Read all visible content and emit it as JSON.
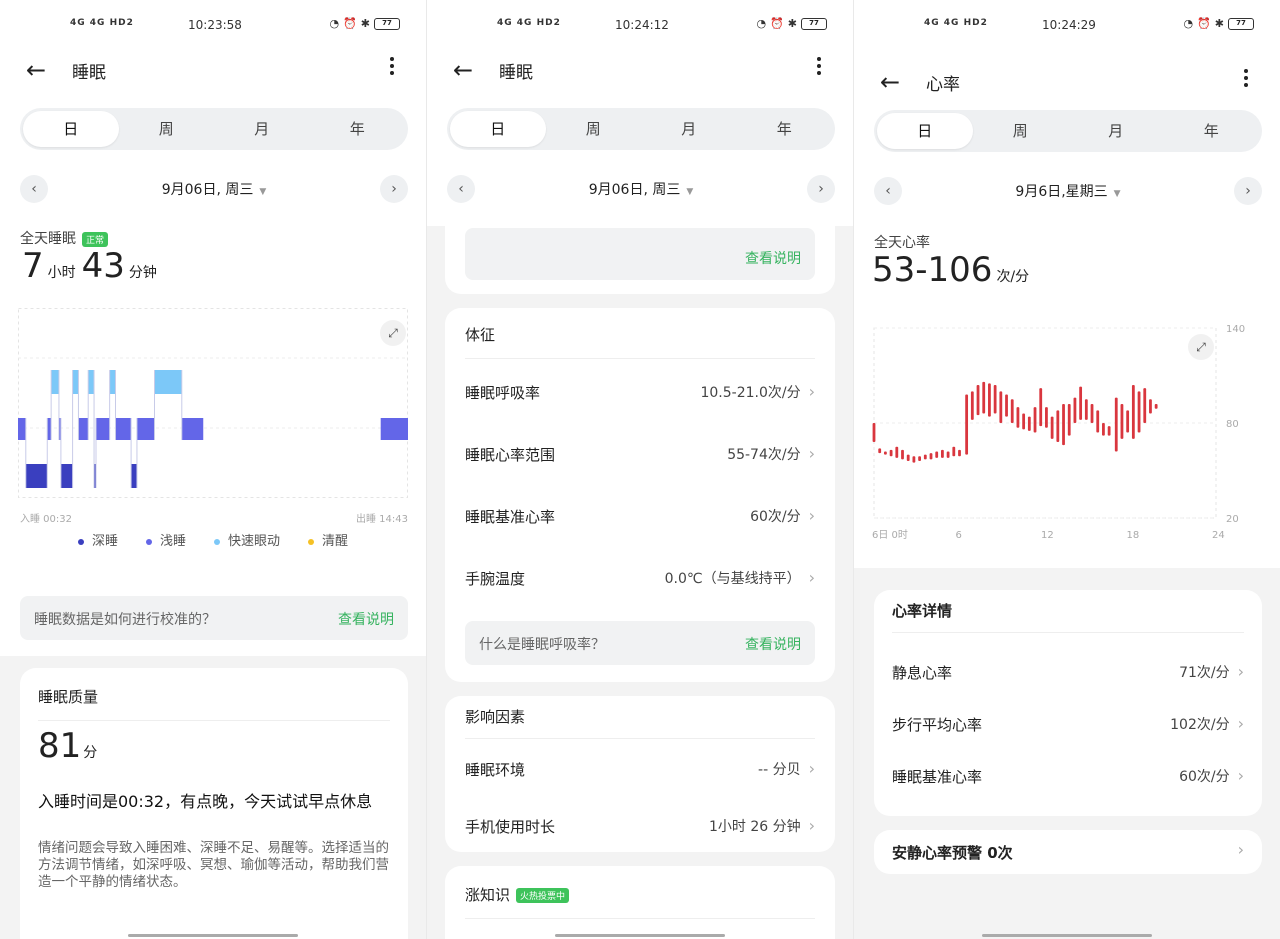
{
  "status": {
    "net": "4G 4G HD2",
    "screen1_time": "10:23:58",
    "screen2_time": "10:24:12",
    "screen3_time": "10:24:29",
    "battery": "77"
  },
  "tabs": [
    "日",
    "周",
    "月",
    "年"
  ],
  "s1": {
    "title": "睡眠",
    "date": "9月06日, 周三",
    "summary_label": "全天睡眠",
    "status_badge": "正常",
    "hours": "7",
    "hours_unit": "小时",
    "minutes": "43",
    "minutes_unit": "分钟",
    "axis_left": "入睡 00:32",
    "axis_right": "出睡 14:43",
    "legend": [
      {
        "label": "深睡",
        "color": "#3a3fbf"
      },
      {
        "label": "浅睡",
        "color": "#6366e8"
      },
      {
        "label": "快速眼动",
        "color": "#7cc8f8"
      },
      {
        "label": "清醒",
        "color": "#f5c125"
      }
    ],
    "calib_question": "睡眠数据是如何进行校准的？",
    "calib_link": "查看说明",
    "quality_title": "睡眠质量",
    "quality_score": "81",
    "quality_unit": "分",
    "advice_title": "入睡时间是00:32，有点晚，今天试试早点休息",
    "advice_body": "情绪问题会导致入睡困难、深睡不足、易醒等。选择适当的方法调节情绪，如深呼吸、冥想、瑜伽等活动，帮助我们营造一个平静的情绪状态。"
  },
  "s2": {
    "title": "睡眠",
    "date": "9月06日, 周三",
    "top_link": "查看说明",
    "vitals_title": "体征",
    "vitals": [
      {
        "label": "睡眠呼吸率",
        "value": "10.5-21.0次/分"
      },
      {
        "label": "睡眠心率范围",
        "value": "55-74次/分"
      },
      {
        "label": "睡眠基准心率",
        "value": "60次/分"
      },
      {
        "label": "手腕温度",
        "value": "0.0℃（与基线持平）"
      }
    ],
    "breath_question": "什么是睡眠呼吸率？",
    "breath_link": "查看说明",
    "factors_title": "影响因素",
    "factors": [
      {
        "label": "睡眠环境",
        "value": "-- 分贝"
      },
      {
        "label": "手机使用时长",
        "value": "1小时 26 分钟"
      }
    ],
    "knowledge_title": "涨知识",
    "knowledge_badge": "火热投票中"
  },
  "s3": {
    "title": "心率",
    "date": "9月6日,星期三",
    "summary_label": "全天心率",
    "range": "53-106",
    "range_unit": "次/分",
    "y_ticks": [
      "140",
      "80",
      "20"
    ],
    "x_ticks": [
      "6日 0时",
      "6",
      "12",
      "18",
      "24"
    ],
    "details_title": "心率详情",
    "details": [
      {
        "label": "静息心率",
        "value": "71次/分"
      },
      {
        "label": "步行平均心率",
        "value": "102次/分"
      },
      {
        "label": "睡眠基准心率",
        "value": "60次/分"
      }
    ],
    "alert": "安静心率预警 0次"
  },
  "chart_data": [
    {
      "type": "bar",
      "title": "",
      "xlabel": "",
      "ylabel": "",
      "x_range_labels": [
        "入睡 00:32",
        "出睡 14:43"
      ],
      "stages": [
        "深睡",
        "浅睡",
        "快速眼动",
        "清醒"
      ],
      "segments": [
        {
          "stage": "浅睡",
          "start": 0.0,
          "end": 0.02
        },
        {
          "stage": "深睡",
          "start": 0.02,
          "end": 0.075
        },
        {
          "stage": "浅睡",
          "start": 0.075,
          "end": 0.085
        },
        {
          "stage": "快速眼动",
          "start": 0.085,
          "end": 0.105
        },
        {
          "stage": "浅睡",
          "start": 0.105,
          "end": 0.11
        },
        {
          "stage": "深睡",
          "start": 0.11,
          "end": 0.14
        },
        {
          "stage": "快速眼动",
          "start": 0.14,
          "end": 0.155
        },
        {
          "stage": "浅睡",
          "start": 0.155,
          "end": 0.18
        },
        {
          "stage": "快速眼动",
          "start": 0.18,
          "end": 0.195
        },
        {
          "stage": "深睡",
          "start": 0.195,
          "end": 0.2
        },
        {
          "stage": "浅睡",
          "start": 0.2,
          "end": 0.235
        },
        {
          "stage": "快速眼动",
          "start": 0.235,
          "end": 0.25
        },
        {
          "stage": "浅睡",
          "start": 0.25,
          "end": 0.29
        },
        {
          "stage": "深睡",
          "start": 0.29,
          "end": 0.305
        },
        {
          "stage": "浅睡",
          "start": 0.305,
          "end": 0.35
        },
        {
          "stage": "快速眼动",
          "start": 0.35,
          "end": 0.42
        },
        {
          "stage": "浅睡",
          "start": 0.42,
          "end": 0.475
        },
        {
          "stage": "浅睡",
          "start": 0.93,
          "end": 1.0
        }
      ]
    },
    {
      "type": "bar",
      "title": "",
      "xlabel": "",
      "ylabel": "",
      "ylim": [
        20,
        140
      ],
      "y_ticks": [
        20,
        80,
        140
      ],
      "x_ticks": [
        "6日 0时",
        "6",
        "12",
        "18",
        "24"
      ],
      "xlim": [
        0,
        24
      ],
      "color": "#d9363e",
      "ranges": [
        {
          "x": 0.0,
          "low": 68,
          "high": 80
        },
        {
          "x": 0.4,
          "low": 61,
          "high": 64
        },
        {
          "x": 0.8,
          "low": 60,
          "high": 62
        },
        {
          "x": 1.2,
          "low": 59,
          "high": 63
        },
        {
          "x": 1.6,
          "low": 58,
          "high": 65
        },
        {
          "x": 2.0,
          "low": 57,
          "high": 63
        },
        {
          "x": 2.4,
          "low": 56,
          "high": 60
        },
        {
          "x": 2.8,
          "low": 55,
          "high": 59
        },
        {
          "x": 3.2,
          "low": 56,
          "high": 59
        },
        {
          "x": 3.6,
          "low": 57,
          "high": 60
        },
        {
          "x": 4.0,
          "low": 57,
          "high": 61
        },
        {
          "x": 4.4,
          "low": 58,
          "high": 62
        },
        {
          "x": 4.8,
          "low": 58,
          "high": 63
        },
        {
          "x": 5.2,
          "low": 58,
          "high": 62
        },
        {
          "x": 5.6,
          "low": 59,
          "high": 65
        },
        {
          "x": 6.0,
          "low": 59,
          "high": 63
        },
        {
          "x": 6.5,
          "low": 60,
          "high": 98
        },
        {
          "x": 6.9,
          "low": 82,
          "high": 100
        },
        {
          "x": 7.3,
          "low": 85,
          "high": 104
        },
        {
          "x": 7.7,
          "low": 86,
          "high": 106
        },
        {
          "x": 8.1,
          "low": 84,
          "high": 105
        },
        {
          "x": 8.5,
          "low": 86,
          "high": 104
        },
        {
          "x": 8.9,
          "low": 80,
          "high": 100
        },
        {
          "x": 9.3,
          "low": 84,
          "high": 98
        },
        {
          "x": 9.7,
          "low": 80,
          "high": 95
        },
        {
          "x": 10.1,
          "low": 77,
          "high": 90
        },
        {
          "x": 10.5,
          "low": 76,
          "high": 86
        },
        {
          "x": 10.9,
          "low": 75,
          "high": 84
        },
        {
          "x": 11.3,
          "low": 74,
          "high": 90
        },
        {
          "x": 11.7,
          "low": 78,
          "high": 102
        },
        {
          "x": 12.1,
          "low": 77,
          "high": 90
        },
        {
          "x": 12.5,
          "low": 70,
          "high": 84
        },
        {
          "x": 12.9,
          "low": 68,
          "high": 88
        },
        {
          "x": 13.3,
          "low": 66,
          "high": 92
        },
        {
          "x": 13.7,
          "low": 72,
          "high": 92
        },
        {
          "x": 14.1,
          "low": 80,
          "high": 96
        },
        {
          "x": 14.5,
          "low": 82,
          "high": 103
        },
        {
          "x": 14.9,
          "low": 82,
          "high": 95
        },
        {
          "x": 15.3,
          "low": 80,
          "high": 92
        },
        {
          "x": 15.7,
          "low": 74,
          "high": 88
        },
        {
          "x": 16.1,
          "low": 72,
          "high": 80
        },
        {
          "x": 16.5,
          "low": 72,
          "high": 78
        },
        {
          "x": 17.0,
          "low": 62,
          "high": 96
        },
        {
          "x": 17.4,
          "low": 70,
          "high": 92
        },
        {
          "x": 17.8,
          "low": 74,
          "high": 88
        },
        {
          "x": 18.2,
          "low": 70,
          "high": 104
        },
        {
          "x": 18.6,
          "low": 74,
          "high": 100
        },
        {
          "x": 19.0,
          "low": 80,
          "high": 102
        },
        {
          "x": 19.4,
          "low": 86,
          "high": 95
        },
        {
          "x": 19.8,
          "low": 89,
          "high": 92
        }
      ]
    }
  ]
}
